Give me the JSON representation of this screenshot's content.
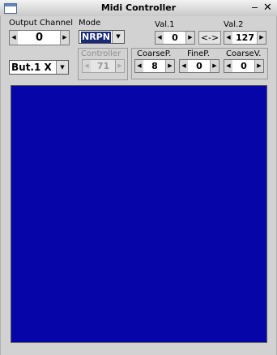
{
  "window": {
    "title": "Midi Controller"
  },
  "output_channel": {
    "label": "Output Channel",
    "value": "0"
  },
  "mode": {
    "label": "Mode",
    "selected": "NRPN"
  },
  "val1": {
    "label": "Val.1",
    "value": "0"
  },
  "swap_label": "<->",
  "val2": {
    "label": "Val.2",
    "value": "127"
  },
  "button_select": {
    "selected": "But.1 X"
  },
  "controller": {
    "label": "Controller",
    "value": "71"
  },
  "coarse_p": {
    "label": "CoarseP.",
    "value": "8"
  },
  "fine_p": {
    "label": "FineP.",
    "value": "0"
  },
  "coarse_v": {
    "label": "CoarseV.",
    "value": "0"
  },
  "colors": {
    "pad": "#0505a8",
    "mode_highlight": "#1a2a7a"
  }
}
